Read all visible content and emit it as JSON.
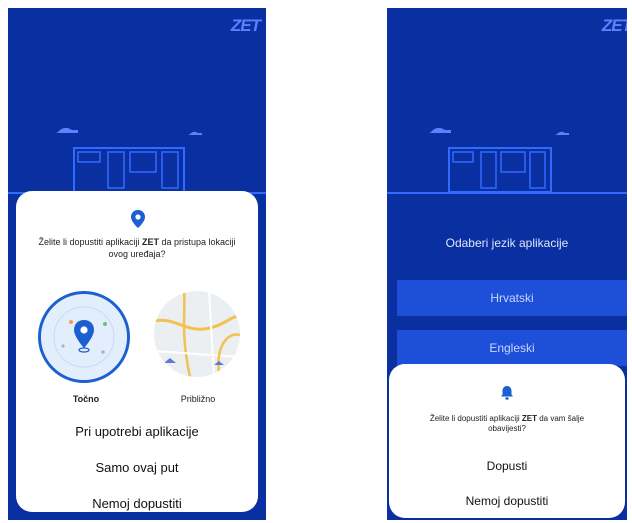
{
  "left_screen": {
    "logo": "ZET",
    "dialog": {
      "prompt_before": "Želite li dopustiti aplikaciji ",
      "prompt_app": "ZET",
      "prompt_after": " da pristupa lokaciji ovog uređaja?",
      "precise_label": "Točno",
      "approximate_label": "Približno",
      "buttons": {
        "while_using": "Pri upotrebi aplikacije",
        "only_once": "Samo ovaj put",
        "deny": "Nemoj dopustiti"
      }
    }
  },
  "right_screen": {
    "logo": "ZET",
    "language_title": "Odaberi jezik aplikacije",
    "languages": [
      "Hrvatski",
      "Engleski"
    ],
    "dialog": {
      "prompt_before": "Želite li dopustiti aplikaciji ",
      "prompt_app": "ZET",
      "prompt_after": " da vam šalje obavijesti?",
      "buttons": {
        "allow": "Dopusti",
        "deny": "Nemoj dopustiti"
      }
    }
  },
  "colors": {
    "background_blue": "#0a2fa0",
    "accent_blue": "#1c5fd0",
    "line_blue": "#2f6bff"
  }
}
